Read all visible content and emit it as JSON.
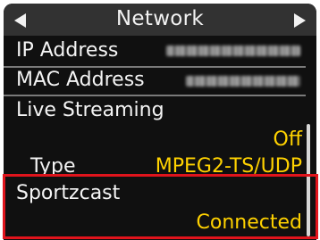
{
  "header": {
    "title": "Network"
  },
  "rows": {
    "ip": {
      "label": "IP Address"
    },
    "mac": {
      "label": "MAC Address"
    },
    "live": {
      "label": "Live Streaming",
      "value": "Off"
    },
    "type": {
      "label": "Type",
      "value": "MPEG2-TS/UDP"
    },
    "sportzcast": {
      "label": "Sportzcast",
      "value": "Connected"
    }
  },
  "colors": {
    "value_text": "#ffd200",
    "highlight": "#e0141c",
    "header_bg": "#323232",
    "panel_bg": "#101010"
  },
  "icons": [
    "left-arrow-icon",
    "right-arrow-icon"
  ]
}
